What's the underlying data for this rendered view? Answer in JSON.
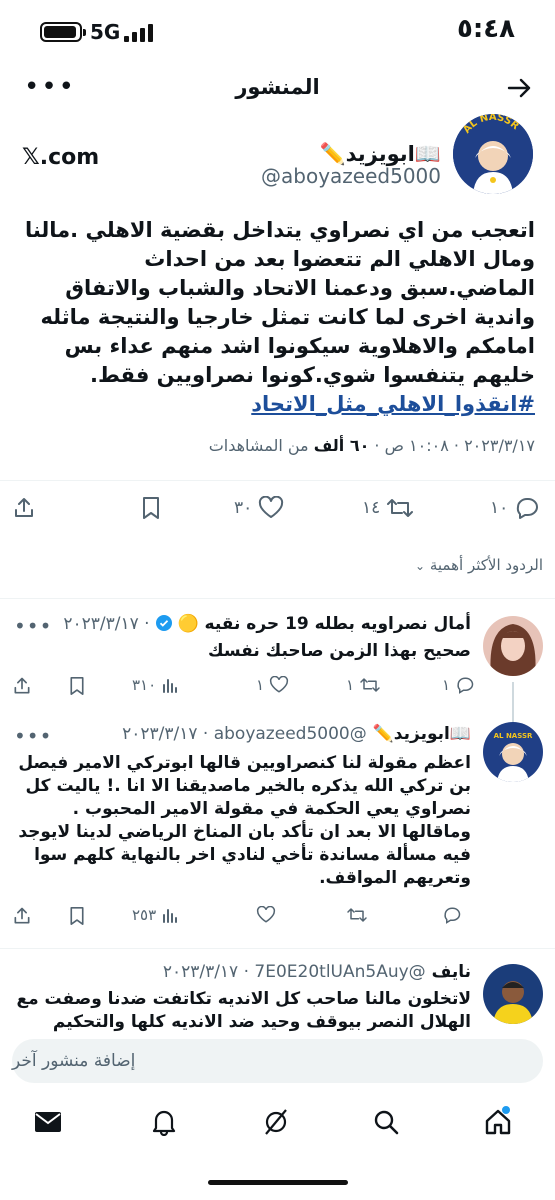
{
  "status_bar": {
    "time": "٥:٤٨",
    "network": "5G",
    "battery_level": 0.95
  },
  "header": {
    "title": "المنشور"
  },
  "main_post": {
    "author_name": "📖ابويزيد✏️",
    "author_handle": "@aboyazeed5000",
    "watermark": "𝕏.com",
    "avatar_text": "AL NASSR",
    "text": "اتعجب من اي نصراوي يتداخل بقضية الاهلي .مالنا ومال الاهلي الم تتعضوا بعد من احداث الماضي.سبق ودعمنا الاتحاد والشباب والاتفاق واندية اخرى لما كانت تمثل خارجيا والنتيجة ماثله امامكم والاهلاوية سيكونوا اشد منهم عداء بس خليهم يتنفسوا شوي.كونوا نصراويين فقط.",
    "hashtag": "#انقذوا_الاهلي_مثل_الاتحاد",
    "meta_time": "٢٠٢٣/٣/١٧ · ١٠:٠٨ ص · ",
    "meta_views": "٦٠ ألف",
    "meta_views_suffix": " من المشاهدات",
    "replies": "١٠",
    "reposts": "١٤",
    "likes": "٣٠"
  },
  "sort_label": "الردود الأكثر أهمية",
  "replies": [
    {
      "name": "أمال نصراويه بطله 19 حره نقيه 🟡",
      "verified": true,
      "date": "٢٠٢٣/٣/١٧",
      "handle": "",
      "text": "صحيح  بهذا الزمن صاحبك نفسك",
      "replies": "١",
      "reposts": "١",
      "likes": "١",
      "views": "٣١٠"
    },
    {
      "name": "📖ابويزيد✏️",
      "verified": false,
      "handle": "@aboyazeed5000",
      "date": "٢٠٢٣/٣/١٧",
      "text": "اعظم مقولة لنا كنصراويين قالها ابوتركي الامير فيصل بن تركي الله يذكره بالخير ماصديقنا الا انا .! ياليت كل نصراوي يعي الحكمة في مقولة الامير المحبوب . وماقالها الا بعد ان تأكد بان المناخ الرياضي لدينا لايوجد فيه مسألة مساندة تأخي لنادي اخر بالنهاية كلهم سوا وتعريهم المواقف.",
      "views": "٢٥٣"
    },
    {
      "name": "نايف",
      "handle": "@7E0E20tlUAn5Auy",
      "date": "٢٠٢٣/٣/١٧",
      "text": "لاتخلون مالنا صاحب كل الانديه تكاتفت ضدنا وصفت مع الهلال النصر بيوقف وحيد ضد الانديه كلها والتحكيم"
    }
  ],
  "compose": {
    "placeholder": "إضافة منشور آخر"
  },
  "colors": {
    "accent": "#1d9bf0",
    "link": "#1d4e9a",
    "muted": "#536471"
  },
  "icons": [
    "back-arrow-icon",
    "more-icon",
    "share-icon",
    "bookmark-icon",
    "heart-icon",
    "repost-icon",
    "reply-icon",
    "views-icon",
    "verified-icon",
    "chevron-down-icon",
    "home-icon",
    "search-icon",
    "grok-icon",
    "bell-icon",
    "mail-icon"
  ]
}
